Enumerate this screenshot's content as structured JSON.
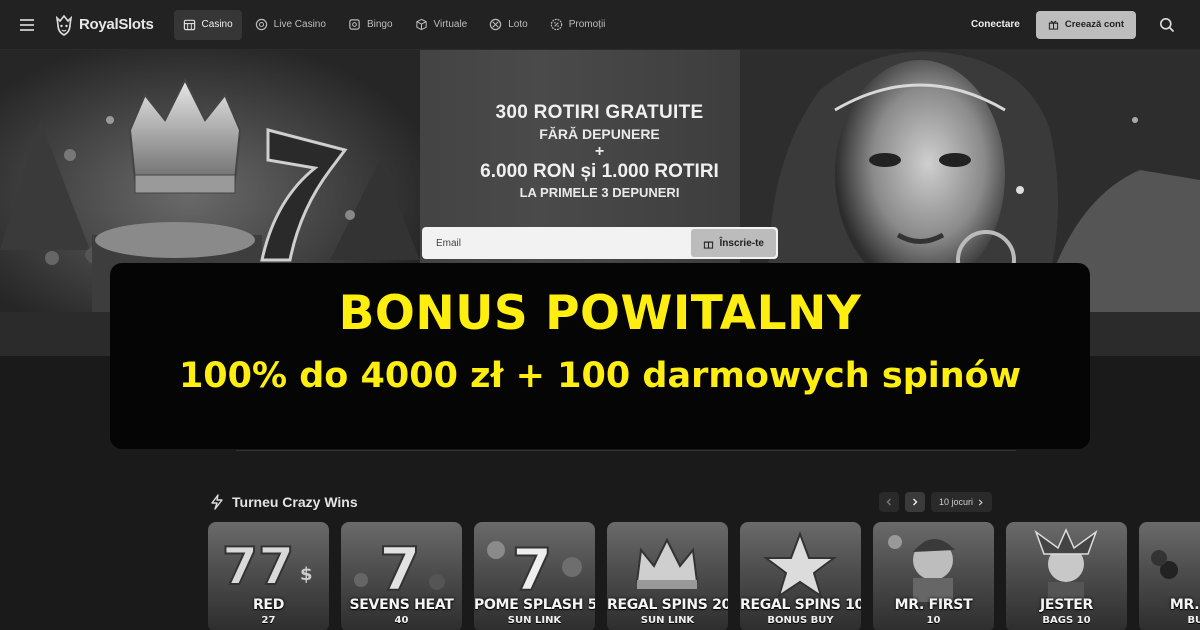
{
  "header": {
    "brand": "RoyalSlots",
    "nav": [
      {
        "label": "Casino",
        "icon": "slot-machine-icon",
        "active": true
      },
      {
        "label": "Live Casino",
        "icon": "chip-icon",
        "active": false
      },
      {
        "label": "Bingo",
        "icon": "bingo-icon",
        "active": false
      },
      {
        "label": "Virtuale",
        "icon": "cube-icon",
        "active": false
      },
      {
        "label": "Loto",
        "icon": "lottery-ball-icon",
        "active": false
      },
      {
        "label": "Promoții",
        "icon": "badge-icon",
        "active": false
      }
    ],
    "login_label": "Conectare",
    "signup_label": "Creează cont"
  },
  "hero": {
    "line1": "300 ROTIRI GRATUITE",
    "line2": "FĂRĂ DEPUNERE",
    "plus": "+",
    "line3": "6.000 RON și 1.000 ROTIRI",
    "line4": "LA PRIMELE 3 DEPUNERI",
    "email_placeholder": "Email",
    "register_label": "Înscrie-te"
  },
  "bonus": {
    "title": "BONUS POWITALNY",
    "subtitle": "100% do 4000 zł + 100 darmowych spinów",
    "color": "#ffee10"
  },
  "section": {
    "title": "Turneu Crazy Wins",
    "count_label": "10 jocuri"
  },
  "games": [
    {
      "name": "RED",
      "sub": "27"
    },
    {
      "name": "SEVENS HEAT",
      "sub": "40"
    },
    {
      "name": "POME SPLASH 5",
      "sub": "SUN LINK"
    },
    {
      "name": "REGAL SPINS 20",
      "sub": "SUN LINK"
    },
    {
      "name": "REGAL SPINS 10",
      "sub": "BONUS BUY"
    },
    {
      "name": "MR. FIRST",
      "sub": "10"
    },
    {
      "name": "JESTER",
      "sub": "BAGS 10"
    },
    {
      "name": "MR. MO",
      "sub": "BUN"
    }
  ]
}
